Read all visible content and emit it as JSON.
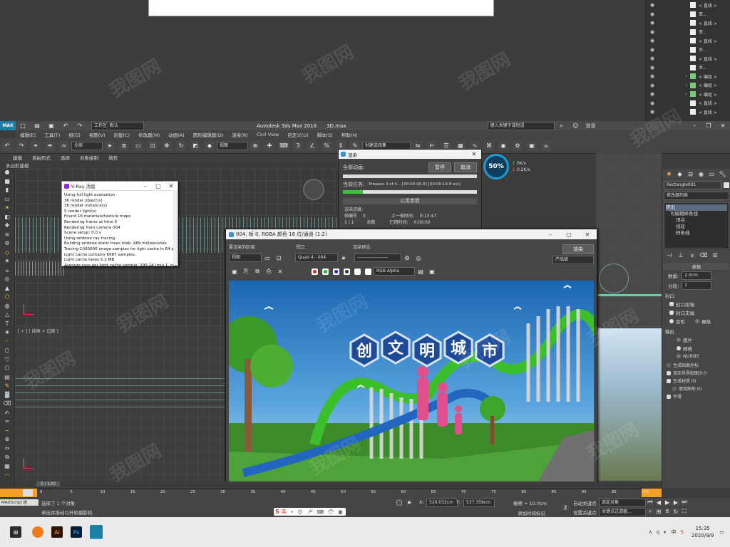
{
  "top_list": {
    "items": [
      {
        "label": "< 直线 >",
        "icon": "spline-icon"
      },
      {
        "label": "亚...",
        "icon": "box-icon"
      },
      {
        "label": "< 直线 >",
        "icon": "spline-icon"
      },
      {
        "label": "亚...",
        "icon": "box-icon"
      },
      {
        "label": "< 直线 >",
        "icon": "spline-icon"
      },
      {
        "label": "木...",
        "icon": "box-icon"
      },
      {
        "label": "< 直线 >",
        "icon": "spline-icon"
      },
      {
        "label": "木...",
        "icon": "box-icon"
      },
      {
        "label": "< 编组 >",
        "icon": "group-icon"
      },
      {
        "label": "< 编组 >",
        "icon": "group-icon"
      },
      {
        "label": "< 编组 >",
        "icon": "group-icon"
      },
      {
        "label": "< 直线 >",
        "icon": "spline-icon"
      },
      {
        "label": "< 直线 >",
        "icon": "spline-icon"
      }
    ]
  },
  "titlebar": {
    "workspace": "工作区: 默认",
    "app_title": "Autodesk 3ds Max 2016",
    "file": "3D.max",
    "search_placeholder": "键入关键字或短语",
    "login": "登录"
  },
  "menu": {
    "items": [
      "编辑(E)",
      "工具(T)",
      "组(G)",
      "视图(V)",
      "创建(C)",
      "修改器(M)",
      "动画(A)",
      "图形编辑器(D)",
      "渲染(R)",
      "Civil View",
      "自定义(U)",
      "脚本(S)",
      "帮助(H)"
    ]
  },
  "toolbar": {
    "filter": "全部",
    "view": "视图",
    "create_selection": "创建选择集"
  },
  "ribbon": {
    "tabs": [
      "建模",
      "自由形式",
      "选择",
      "对象绘制",
      "填充"
    ],
    "sub": "多边形建模"
  },
  "perf": {
    "percent": "50%",
    "up": "0K/s",
    "down": "0.2K/s"
  },
  "vray": {
    "title": "V-Ray 消息",
    "lines": [
      "Using full light evaluation",
      "36 render object(s)",
      "36 render instance(s)",
      "5 render light(s)",
      "Found 16 materials/texture maps",
      "Rendering frame at time 0",
      "Rendering from camera 004",
      "Scene setup: 0.0 s",
      "Using embree ray tracing.",
      "Building embree static trees took: 489 milliseconds",
      "Tracing 1000000 image samples for light cache in 64 passes",
      "Light cache contains 6687 samples.",
      "Light cache takes 5.2 MB",
      "Average rays per light cache sample: 290.24 (min 1, max 33"
    ]
  },
  "render_progress": {
    "title": "渲染",
    "total_label": "全部动画:",
    "current_label": "当前任务:",
    "current_task": "Prepass 3 of 4... [00:00:06.8] [00:00:19.8 est]",
    "pause": "暂停",
    "cancel": "取消",
    "params_header": "公用参数",
    "progress_label": "渲染进度:",
    "frame_label": "帧编号",
    "frame_value": "0",
    "last_frame_label": "上一帧时间:",
    "last_frame_value": "0:13:47",
    "total_label2": "总数",
    "elapsed_label": "已用时间:",
    "elapsed_value": "0:00:00",
    "count": "1 / 1",
    "total_progress": 0.0,
    "current_progress": 0.15
  },
  "frame_window": {
    "title": "004, 帧 0, RGBA 颜色 16 位/通道 (1:2)",
    "area_label": "要渲染的区域:",
    "area_value": "视图",
    "viewport_label": "视口:",
    "viewport_value": "Quad 4 - 004",
    "preset_label": "渲染预设:",
    "preset_value": "--------------------",
    "render_button": "渲染",
    "product_value": "产品级",
    "channel_value": "RGB Alpha",
    "sign_text": [
      "创",
      "文",
      "明",
      "城",
      "市"
    ]
  },
  "modify_panel": {
    "object_name": "Rectangle001",
    "modifier_list": "修改器列表",
    "stack": [
      "挤出",
      "可编辑样条线",
      "顶点",
      "线段",
      "样条线"
    ],
    "params_header": "参数",
    "amount_label": "数量:",
    "amount_value": "2.0cm",
    "segments_label": "分段:",
    "segments_value": "1",
    "capping_header": "封口",
    "cap_start": "封口始端",
    "cap_end": "封口末端",
    "morph": "变形",
    "grid": "栅格",
    "output_header": "输出",
    "output_options": [
      "面片",
      "网格",
      "NURBS"
    ],
    "checks": [
      "生成贴图坐标",
      "真实世界贴图大小",
      "生成材质 ID",
      "使用图形 ID",
      "平滑"
    ]
  },
  "timeline": {
    "frame_indicator": "0 / 100",
    "ticks": [
      "0",
      "5",
      "10",
      "15",
      "20",
      "25",
      "30",
      "35",
      "40",
      "45",
      "50",
      "55",
      "60",
      "65",
      "70",
      "75",
      "80",
      "85",
      "90",
      "95",
      "100"
    ]
  },
  "status": {
    "maxscript": "MAXScript 迷",
    "selected": "选择了 1 个对象",
    "hint": "单击并拖动以开始摄影机",
    "x": "520.032cm",
    "y": "537.359cm",
    "grid": "栅格 = 10.0cm",
    "autokey": "自动关键点",
    "set_key": "设置关键点",
    "selection_set": "选定对象",
    "key_filter": "关键点过滤器...",
    "add_time_tag": "添加时间标记"
  },
  "taskbar": {
    "time": "15:35",
    "date": "2020/9/9",
    "ime": "英"
  },
  "watermark": "我图网",
  "colors": {
    "accent": "#1f9bd6",
    "green_progress": "#39c43a",
    "sky": "#2b84c8"
  }
}
